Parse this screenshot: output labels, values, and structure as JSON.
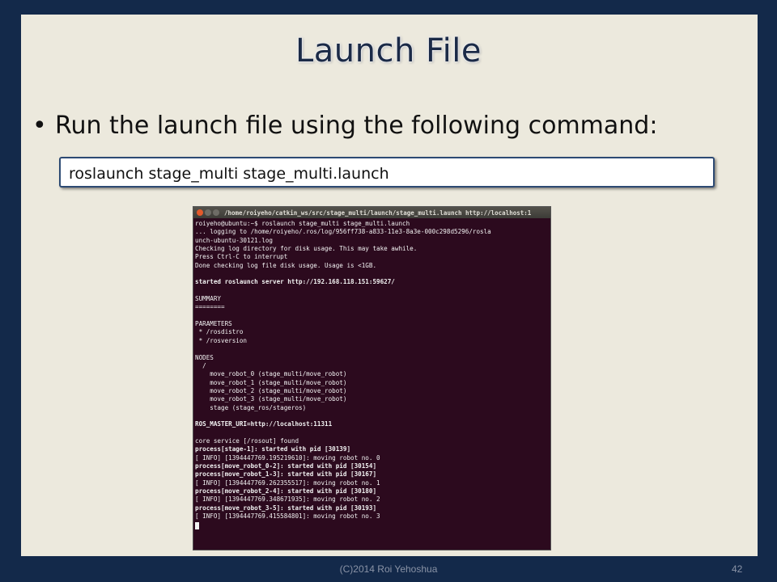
{
  "slide": {
    "title": "Launch File",
    "bullet": "Run the launch file using the following command:",
    "command": "roslaunch stage_multi stage_multi.launch"
  },
  "terminal": {
    "window_title": "/home/roiyeho/catkin_ws/src/stage_multi/launch/stage_multi.launch http://localhost:1",
    "lines": [
      {
        "text": "roiyeho@ubuntu:~$ roslaunch stage_multi stage_multi.launch",
        "bold": false
      },
      {
        "text": "... logging to /home/roiyeho/.ros/log/956ff738-a833-11e3-8a3e-000c298d5296/rosla",
        "bold": false
      },
      {
        "text": "unch-ubuntu-30121.log",
        "bold": false
      },
      {
        "text": "Checking log directory for disk usage. This may take awhile.",
        "bold": false
      },
      {
        "text": "Press Ctrl-C to interrupt",
        "bold": false
      },
      {
        "text": "Done checking log file disk usage. Usage is <1GB.",
        "bold": false
      },
      {
        "text": "",
        "bold": false
      },
      {
        "text": "started roslaunch server http://192.168.118.151:59627/",
        "bold": true
      },
      {
        "text": "",
        "bold": false
      },
      {
        "text": "SUMMARY",
        "bold": false
      },
      {
        "text": "========",
        "bold": false
      },
      {
        "text": "",
        "bold": false
      },
      {
        "text": "PARAMETERS",
        "bold": false
      },
      {
        "text": " * /rosdistro",
        "bold": false
      },
      {
        "text": " * /rosversion",
        "bold": false
      },
      {
        "text": "",
        "bold": false
      },
      {
        "text": "NODES",
        "bold": false
      },
      {
        "text": "  /",
        "bold": false
      },
      {
        "text": "    move_robot_0 (stage_multi/move_robot)",
        "bold": false
      },
      {
        "text": "    move_robot_1 (stage_multi/move_robot)",
        "bold": false
      },
      {
        "text": "    move_robot_2 (stage_multi/move_robot)",
        "bold": false
      },
      {
        "text": "    move_robot_3 (stage_multi/move_robot)",
        "bold": false
      },
      {
        "text": "    stage (stage_ros/stageros)",
        "bold": false
      },
      {
        "text": "",
        "bold": false
      },
      {
        "text": "ROS_MASTER_URI=http://localhost:11311",
        "bold": true
      },
      {
        "text": "",
        "bold": false
      },
      {
        "text": "core service [/rosout] found",
        "bold": false
      },
      {
        "text": "process[stage-1]: started with pid [30139]",
        "bold": true
      },
      {
        "text": "[ INFO] [1394447769.195219610]: moving robot no. 0",
        "bold": false
      },
      {
        "text": "process[move_robot_0-2]: started with pid [30154]",
        "bold": true
      },
      {
        "text": "process[move_robot_1-3]: started with pid [30167]",
        "bold": true
      },
      {
        "text": "[ INFO] [1394447769.262355517]: moving robot no. 1",
        "bold": false
      },
      {
        "text": "process[move_robot_2-4]: started with pid [30180]",
        "bold": true
      },
      {
        "text": "[ INFO] [1394447769.348671935]: moving robot no. 2",
        "bold": false
      },
      {
        "text": "process[move_robot_3-5]: started with pid [30193]",
        "bold": true
      },
      {
        "text": "[ INFO] [1394447769.415584801]: moving robot no. 3",
        "bold": false
      }
    ]
  },
  "footer": {
    "copyright": "(C)2014 Roi Yehoshua",
    "page_number": "42"
  },
  "colors": {
    "frame": "#13294a",
    "slide_bg": "#ece9dd",
    "terminal_bg": "#2c0a1e",
    "command_border": "#2d4a73",
    "close_button": "#e3592b",
    "window_button": "#6e6c66"
  }
}
